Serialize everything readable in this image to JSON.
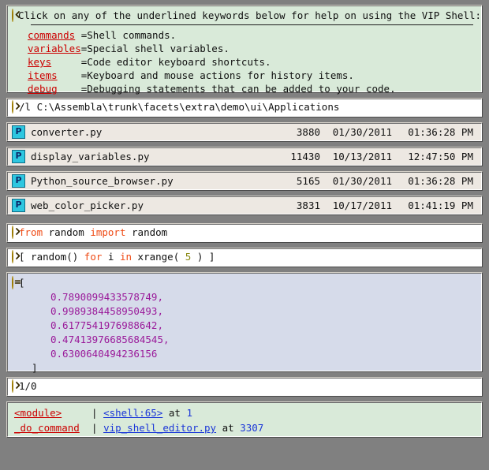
{
  "shell": {
    "name": "VIP Shell",
    "colors": {
      "background": "#808080",
      "help_panel": "#d9ead9",
      "file_row": "#ede8e2",
      "output_panel": "#d6dbea",
      "keyword_link": "#cc0000",
      "file_link": "#1a36d8",
      "syntax_keyword": "#ef4a14",
      "syntax_number": "#8a8a14",
      "result_value": "#9a1a9a",
      "icon_yellow": "#f5cf25",
      "icon_python": "#2ec7e0"
    }
  },
  "help": {
    "icon": "chevron-left-circle-icon",
    "title": "Click on any of the underlined keywords below for help on using the VIP Shell:",
    "entries": [
      {
        "keyword": "commands",
        "eq": "=",
        "description": "Shell commands."
      },
      {
        "keyword": "variables",
        "eq": "=",
        "description": "Special shell variables."
      },
      {
        "keyword": "keys",
        "eq": "=",
        "description": "Code editor keyboard shortcuts."
      },
      {
        "keyword": "items",
        "eq": "=",
        "description": "Keyboard and mouse actions for history items."
      },
      {
        "keyword": "debug",
        "eq": "=",
        "description": "Debugging statements that can be added to your code."
      }
    ]
  },
  "path_command": {
    "icon": "chevron-right-circle-icon",
    "text": "/l C:\\Assembla\\trunk\\facets\\extra\\demo\\ui\\Applications"
  },
  "files": [
    {
      "icon": "python-file-icon",
      "name": "converter.py",
      "size": "3880",
      "date": "01/30/2011",
      "time": "01:36:28 PM"
    },
    {
      "icon": "python-file-icon",
      "name": "display_variables.py",
      "size": "11430",
      "date": "10/13/2011",
      "time": "12:47:50 PM"
    },
    {
      "icon": "python-file-icon",
      "name": "Python_source_browser.py",
      "size": "5165",
      "date": "01/30/2011",
      "time": "01:36:28 PM"
    },
    {
      "icon": "python-file-icon",
      "name": "web_color_picker.py",
      "size": "3831",
      "date": "10/17/2011",
      "time": "01:41:19 PM"
    }
  ],
  "commands": [
    {
      "icon": "chevron-right-circle-icon",
      "tokens": [
        {
          "t": "from ",
          "k": "kw"
        },
        {
          "t": "random ",
          "k": "pl"
        },
        {
          "t": "import ",
          "k": "kw"
        },
        {
          "t": "random",
          "k": "pl"
        }
      ]
    },
    {
      "icon": "chevron-right-circle-icon",
      "tokens": [
        {
          "t": "[ random() ",
          "k": "pl"
        },
        {
          "t": "for ",
          "k": "kw"
        },
        {
          "t": "i ",
          "k": "pl"
        },
        {
          "t": "in ",
          "k": "kw"
        },
        {
          "t": "xrange( ",
          "k": "pl"
        },
        {
          "t": "5",
          "k": "num"
        },
        {
          "t": " ) ]",
          "k": "pl"
        }
      ]
    }
  ],
  "result": {
    "icon": "equals-circle-icon",
    "open_bracket": "[",
    "values": [
      "0.7890099433578749,",
      "0.9989384458950493,",
      "0.6177541976988642,",
      "0.47413976685684545,",
      "0.6300640494236156"
    ],
    "close_bracket": "]"
  },
  "error_command": {
    "icon": "chevron-right-circle-icon",
    "text": "1/0"
  },
  "traceback": {
    "rows": [
      {
        "function": "<module>",
        "bar": "|",
        "location": "<shell:65>",
        "at": "at",
        "line": "1"
      },
      {
        "function": "_do_command",
        "bar": "|",
        "location": "vip_shell_editor.py",
        "at": "at",
        "line": "3307"
      }
    ]
  }
}
